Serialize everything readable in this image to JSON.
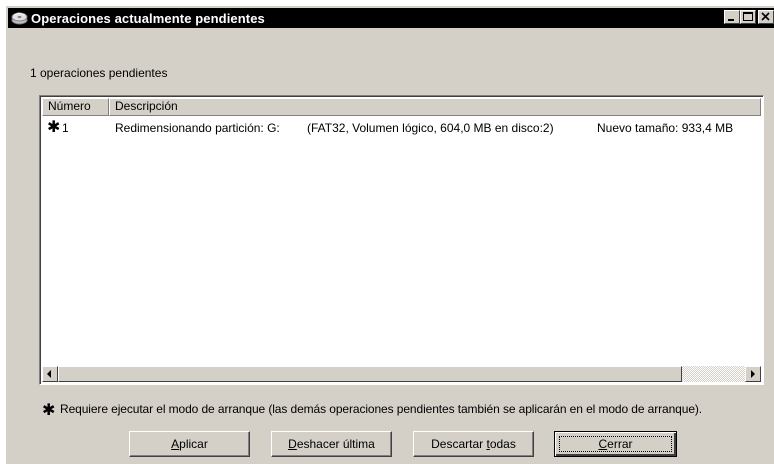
{
  "window": {
    "title": "Operaciones actualmente pendientes"
  },
  "summary": {
    "pending_count_text": "1 operaciones pendientes"
  },
  "list": {
    "columns": [
      {
        "label": "Número"
      },
      {
        "label": "Descripción"
      }
    ],
    "rows": [
      {
        "marker": "✱",
        "number": "1",
        "description": "Redimensionando partición: G:",
        "detail": "(FAT32, Volumen lógico, 604,0 MB en disco:2)",
        "new_size": "Nuevo tamaño: 933,4 MB"
      }
    ]
  },
  "note": {
    "marker": "✱",
    "text": "Requiere ejecutar el modo de arranque (las demás operaciones pendientes también se aplicarán en el modo de arranque)."
  },
  "buttons": {
    "apply": {
      "accel": "A",
      "rest": "plicar"
    },
    "undo": {
      "accel": "D",
      "rest": "eshacer última"
    },
    "discard": {
      "pre": "Descartar ",
      "accel": "t",
      "rest": "odas"
    },
    "close": {
      "accel": "C",
      "rest": "errar"
    }
  },
  "colors": {
    "titlebar": "#000000",
    "face": "#d4d0c8",
    "list_bg": "#ffffff"
  }
}
